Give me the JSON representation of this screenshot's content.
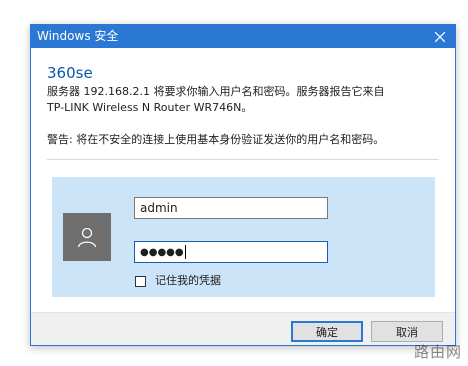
{
  "window": {
    "title": "Windows 安全",
    "close_icon": "close-icon",
    "accent_color": "#2b78d4"
  },
  "app_name": "360se",
  "message": {
    "line1": "服务器 192.168.2.1 将要求你输入用户名和密码。服务器报告它来自",
    "line2": "TP-LINK Wireless N Router WR746N。",
    "warning": "警告: 将在不安全的连接上使用基本身份验证发送你的用户名和密码。"
  },
  "credentials": {
    "avatar_icon": "user-icon",
    "username": "admin",
    "password_mask": "●●●●●",
    "remember_label": "记住我的凭据",
    "remember_checked": false
  },
  "buttons": {
    "ok": "确定",
    "cancel": "取消"
  },
  "watermark": "路由网"
}
